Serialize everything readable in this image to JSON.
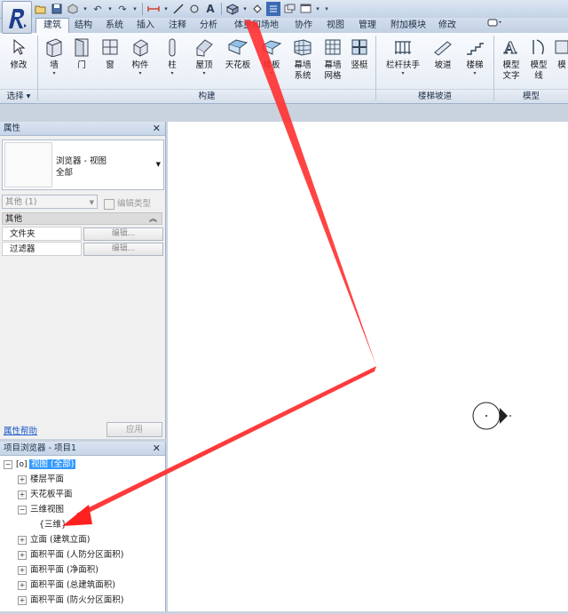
{
  "colors": {
    "accent": "#3399ff",
    "arrow": "#ff2a2a",
    "ribbon_bg": "#eef2f8"
  },
  "qat": {
    "icons": [
      "open-icon",
      "save-icon",
      "sync-icon",
      "undo-icon",
      "redo-icon",
      "measure-icon",
      "dimension-icon",
      "tag-icon",
      "text-icon",
      "3d-view-icon",
      "section-icon",
      "thin-lines-icon",
      "close-hidden-icon",
      "switch-windows-icon",
      "customize-icon"
    ]
  },
  "tabs": [
    "建筑",
    "结构",
    "系统",
    "插入",
    "注释",
    "分析",
    "体量和场地",
    "协作",
    "视图",
    "管理",
    "附加模块",
    "修改"
  ],
  "ribbon": {
    "modify": "修改",
    "wall": "墙",
    "door": "门",
    "window": "窗",
    "component": "构件",
    "column": "柱",
    "roof": "屋顶",
    "ceiling": "天花板",
    "floor": "楼板",
    "curtain_system_1": "幕墙",
    "curtain_system_2": "系统",
    "curtain_grid_1": "幕墙",
    "curtain_grid_2": "网格",
    "mullion": "竖梃",
    "railing": "栏杆扶手",
    "ramp": "坡道",
    "stair": "楼梯",
    "model_text_1": "模型",
    "model_text_2": "文字",
    "model_line_1": "模型",
    "model_line_2": "线",
    "model_group": "模",
    "panels": {
      "select": "选择 ▾",
      "build": "构建",
      "circulation": "楼梯坡道",
      "model": "模型"
    }
  },
  "properties": {
    "title": "属性",
    "type_name_1": "浏览器 - 视图",
    "type_name_2": "全部",
    "instance_filter": "其他 (1)",
    "edit_type": "编辑类型",
    "group": "其他",
    "rows": [
      {
        "key": "文件夹",
        "value": "编辑..."
      },
      {
        "key": "过滤器",
        "value": "编辑..."
      }
    ],
    "help": "属性帮助",
    "apply": "应用"
  },
  "browser": {
    "title": "项目浏览器 - 项目1",
    "root": "视图 (全部)",
    "items": [
      "楼层平面",
      "天花板平面",
      "三维视图",
      "{三维}",
      "立面 (建筑立面)",
      "面积平面 (人防分区面积)",
      "面积平面 (净面积)",
      "面积平面 (总建筑面积)",
      "面积平面 (防火分区面积)"
    ]
  }
}
